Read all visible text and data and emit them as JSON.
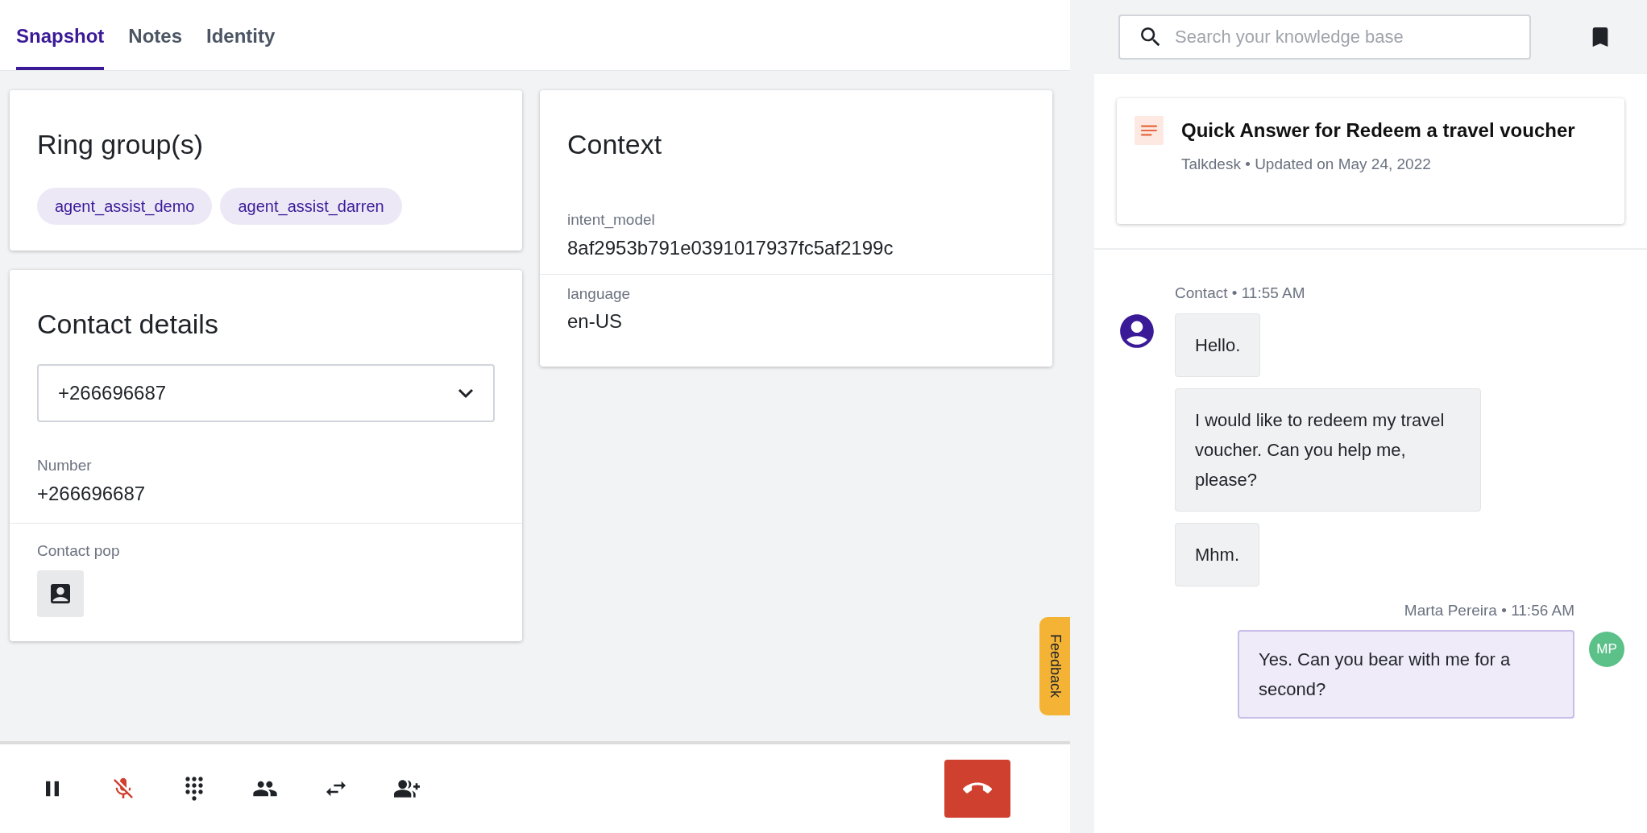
{
  "tabs": [
    {
      "label": "Snapshot",
      "selected": true
    },
    {
      "label": "Notes",
      "selected": false
    },
    {
      "label": "Identity",
      "selected": false
    }
  ],
  "ring_groups": {
    "title": "Ring group(s)",
    "tags": [
      "agent_assist_demo",
      "agent_assist_darren"
    ]
  },
  "contact_details": {
    "title": "Contact details",
    "select_value": "+266696687",
    "fields": [
      {
        "label": "Number",
        "value": "+266696687"
      }
    ],
    "contact_pop_label": "Contact pop"
  },
  "context": {
    "title": "Context",
    "fields": [
      {
        "label": "intent_model",
        "value": "8af2953b791e0391017937fc5af2199c"
      },
      {
        "label": "language",
        "value": "en-US"
      }
    ]
  },
  "call_controls": [
    {
      "kind": "hold",
      "muted": false
    },
    {
      "kind": "mute",
      "muted": true
    },
    {
      "kind": "dialpad",
      "muted": false
    },
    {
      "kind": "transfer",
      "muted": false
    },
    {
      "kind": "swap",
      "muted": false
    },
    {
      "kind": "conference",
      "muted": false
    }
  ],
  "feedback": "Feedback",
  "search": {
    "placeholder": "Search your knowledge base"
  },
  "quick_answer": {
    "title": "Quick Answer for Redeem a travel voucher",
    "meta": "Talkdesk • Updated on May 24, 2022"
  },
  "messages": [
    {
      "kind": "contact",
      "header": "Contact • 11:55 AM",
      "bubbles": [
        "Hello.",
        "I would like to redeem my travel voucher. Can you help me, please?",
        "Mhm."
      ]
    },
    {
      "kind": "agent",
      "header": "Marta Pereira • 11:56 AM",
      "initials": "MP",
      "bubbles": [
        "Yes. Can you bear with me for a second?"
      ]
    }
  ]
}
